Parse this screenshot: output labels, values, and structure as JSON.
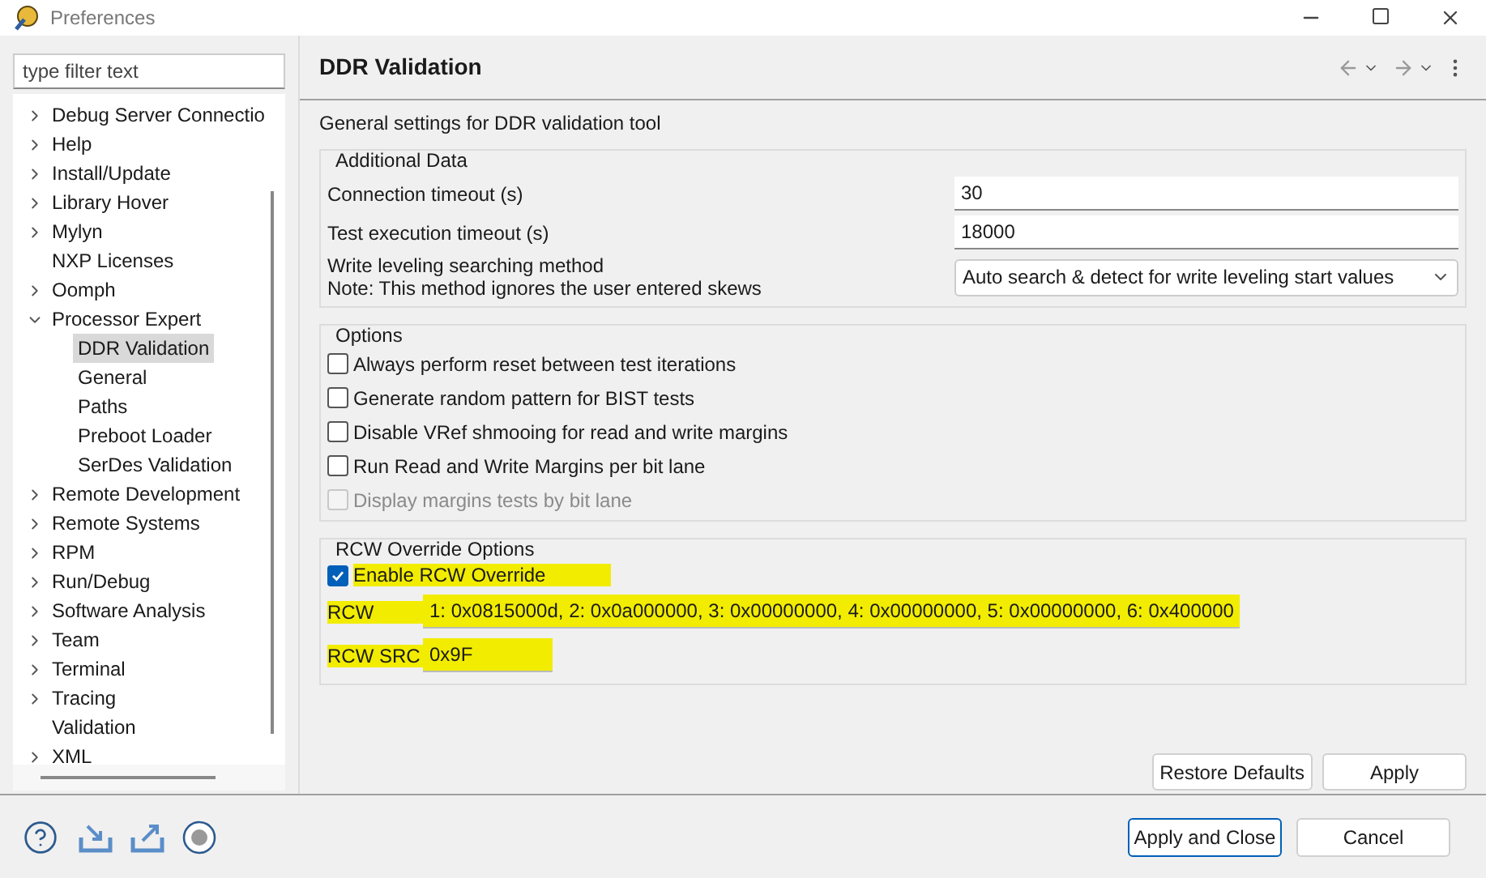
{
  "window": {
    "title": "Preferences"
  },
  "filter": {
    "placeholder": "type filter text"
  },
  "tree": [
    {
      "label": "Debug Server Connectio",
      "kind": "group",
      "expanded": false,
      "selected": false
    },
    {
      "label": "Help",
      "kind": "group",
      "expanded": false,
      "selected": false
    },
    {
      "label": "Install/Update",
      "kind": "group",
      "expanded": false,
      "selected": false
    },
    {
      "label": "Library Hover",
      "kind": "group",
      "expanded": false,
      "selected": false
    },
    {
      "label": "Mylyn",
      "kind": "group",
      "expanded": false,
      "selected": false
    },
    {
      "label": "NXP Licenses",
      "kind": "page",
      "selected": false
    },
    {
      "label": "Oomph",
      "kind": "group",
      "expanded": false,
      "selected": false
    },
    {
      "label": "Processor Expert",
      "kind": "group",
      "expanded": true,
      "selected": false,
      "children": [
        {
          "label": "DDR Validation",
          "kind": "page",
          "selected": true
        },
        {
          "label": "General",
          "kind": "page",
          "selected": false
        },
        {
          "label": "Paths",
          "kind": "page",
          "selected": false
        },
        {
          "label": "Preboot Loader",
          "kind": "page",
          "selected": false
        },
        {
          "label": "SerDes Validation",
          "kind": "page",
          "selected": false
        }
      ]
    },
    {
      "label": "Remote Development",
      "kind": "group",
      "expanded": false,
      "selected": false
    },
    {
      "label": "Remote Systems",
      "kind": "group",
      "expanded": false,
      "selected": false
    },
    {
      "label": "RPM",
      "kind": "group",
      "expanded": false,
      "selected": false
    },
    {
      "label": "Run/Debug",
      "kind": "group",
      "expanded": false,
      "selected": false
    },
    {
      "label": "Software Analysis",
      "kind": "group",
      "expanded": false,
      "selected": false
    },
    {
      "label": "Team",
      "kind": "group",
      "expanded": false,
      "selected": false
    },
    {
      "label": "Terminal",
      "kind": "group",
      "expanded": false,
      "selected": false
    },
    {
      "label": "Tracing",
      "kind": "group",
      "expanded": false,
      "selected": false
    },
    {
      "label": "Validation",
      "kind": "page",
      "selected": false
    },
    {
      "label": "XML",
      "kind": "group",
      "expanded": false,
      "selected": false
    }
  ],
  "page": {
    "title": "DDR Validation",
    "description": "General settings for DDR validation tool",
    "additional_data": {
      "title": "Additional Data",
      "rows": [
        {
          "kind": "text",
          "label": "Connection timeout (s)",
          "value": "30"
        },
        {
          "kind": "text",
          "label": "Test execution timeout (s)",
          "value": "18000"
        },
        {
          "kind": "select",
          "label": "Write leveling searching method",
          "note": "Note: This method ignores the user entered skews",
          "value": "Auto search & detect for write leveling start values"
        }
      ]
    },
    "options": {
      "title": "Options",
      "items": [
        {
          "label": "Always perform reset between test iterations",
          "checked": false,
          "disabled": false
        },
        {
          "label": "Generate random pattern for BIST tests",
          "checked": false,
          "disabled": false
        },
        {
          "label": "Disable VRef shmooing for read and write margins",
          "checked": false,
          "disabled": false
        },
        {
          "label": "Run Read and Write Margins per bit lane",
          "checked": false,
          "disabled": false
        },
        {
          "label": "Display margins tests by bit lane",
          "checked": false,
          "disabled": true
        }
      ]
    },
    "rcw": {
      "title": "RCW Override Options",
      "enable": {
        "label": "Enable RCW Override",
        "checked": true,
        "highlighted": true
      },
      "fields": [
        {
          "label": "RCW",
          "value": "1: 0x0815000d, 2: 0x0a000000, 3: 0x00000000, 4: 0x00000000, 5: 0x00000000, 6: 0x400000",
          "highlighted": true
        },
        {
          "label": "RCW SRC",
          "value": "0x9F",
          "highlighted": true
        }
      ]
    },
    "buttons": [
      "Restore Defaults",
      "Apply"
    ]
  },
  "footer_buttons": [
    {
      "label": "Apply and Close",
      "default": true
    },
    {
      "label": "Cancel",
      "default": false
    }
  ]
}
